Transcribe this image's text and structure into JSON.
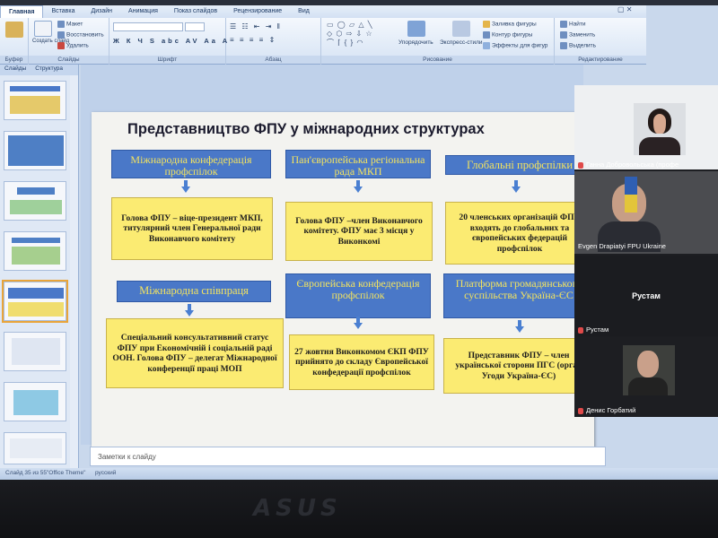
{
  "ribbon": {
    "tabs": [
      "Главная",
      "Вставка",
      "Дизайн",
      "Анимация",
      "Показ слайдов",
      "Рецензирование",
      "Вид"
    ],
    "clipboard": {
      "paste": "Вставить",
      "create_slide": "Создать\nслайд",
      "layout": "Макет",
      "restore": "Восстановить",
      "delete": "Удалить"
    },
    "groups": {
      "slides": "Слайды",
      "font": "Шрифт",
      "paragraph": "Абзац",
      "drawing": "Рисование",
      "editing": "Редактирование",
      "clipboard": "Буфер обмена"
    },
    "drawing": {
      "arrange": "Упорядочить",
      "quick_styles": "Экспресс-стили",
      "fill": "Заливка фигуры",
      "outline": "Контур фигуры",
      "effects": "Эффекты для фигур"
    },
    "editing": {
      "find": "Найти",
      "replace": "Заменить",
      "select": "Выделить"
    }
  },
  "left_panel": {
    "tabs": [
      "Слайды",
      "Структура"
    ]
  },
  "slide": {
    "title": "Представництво ФПУ у міжнародних структурах",
    "boxes": [
      {
        "header": "Міжнародна конфедерація профспілок",
        "body": "Голова ФПУ – віце-президент МКП, титулярний член Генеральної ради Виконавчого комітету"
      },
      {
        "header": "Пан'європейська регіональна рада МКП",
        "body": "Голова ФПУ –член Виконавчого комітету. ФПУ має 3 місця у Виконкомі"
      },
      {
        "header": "Глобальні профспілки",
        "body": "20 членських організацій ФПУ входять до глобальних та європейських федерацій профспілок"
      },
      {
        "header": "Міжнародна співпраця",
        "body": "Спеціальний консультативний статус ФПУ при Економічній і соціальній раді ООН. Голова ФПУ – делегат Міжнародної конференції праці МОП"
      },
      {
        "header": "Європейська конфедерація профспілок",
        "body": "27 жовтня Виконкомом ЄКП ФПУ прийнято до складу Європейської конфедерації профспілок"
      },
      {
        "header": "Платформа громадянського суспільства Україна-ЄС",
        "body": "Представник ФПУ – член української сторони ПГС (орган Угоди Україна-ЄС)"
      }
    ]
  },
  "notes": {
    "placeholder": "Заметки к слайду"
  },
  "status": {
    "slide": "Слайд 35 из 55",
    "theme": "\"Office Theme\"",
    "lang": "русский"
  },
  "zoom": {
    "participants": [
      {
        "name": "Ганна Добровольська (профе"
      },
      {
        "name": "Evgen Drapiatyi FPU Ukraine"
      },
      {
        "name": "Рустам",
        "label": "Рустам"
      },
      {
        "name": "Денис Горбатий"
      }
    ]
  },
  "brand": "ASUS"
}
